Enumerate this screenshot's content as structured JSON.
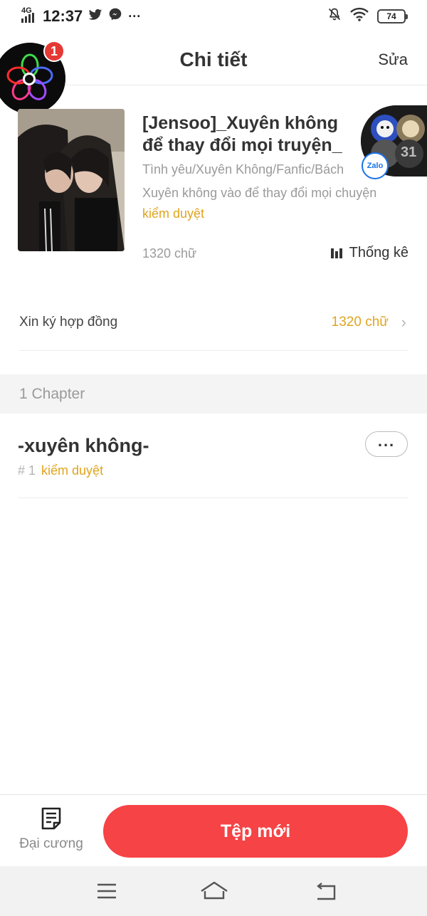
{
  "status_bar": {
    "network": "4G",
    "time": "12:37",
    "battery": "74",
    "icons": [
      "signal-icon",
      "twitter-icon",
      "messenger-icon",
      "more-notifications-icon",
      "mute-bell-icon",
      "wifi-icon",
      "battery-icon"
    ]
  },
  "header": {
    "title": "Chi tiết",
    "edit_label": "Sửa"
  },
  "bubble": {
    "badge_count": "1",
    "zalo_label": "Zalo",
    "avatar_count": "31"
  },
  "book": {
    "title": "[Jensoo]_Xuyên không để thay đổi mọi truyện_",
    "genre": "Tình yêu/Xuyên Không/Fanfic/Bách",
    "description": "Xuyên không vào để thay đổi mọi chuyện",
    "status": "kiểm duyệt",
    "word_count": "1320 chữ",
    "stats_label": "Thống kê"
  },
  "contract": {
    "label": "Xin ký hợp đồng",
    "value": "1320 chữ"
  },
  "chapters": {
    "count_label": "1 Chapter",
    "items": [
      {
        "title": "-xuyên không-",
        "number": "# 1",
        "status": "kiểm duyệt"
      }
    ]
  },
  "bottom_bar": {
    "outline_label": "Đại cương",
    "new_button_label": "Tệp mới"
  },
  "colors": {
    "accent": "#f64346",
    "status": "#e0a41f",
    "muted": "#9a9a9a"
  }
}
